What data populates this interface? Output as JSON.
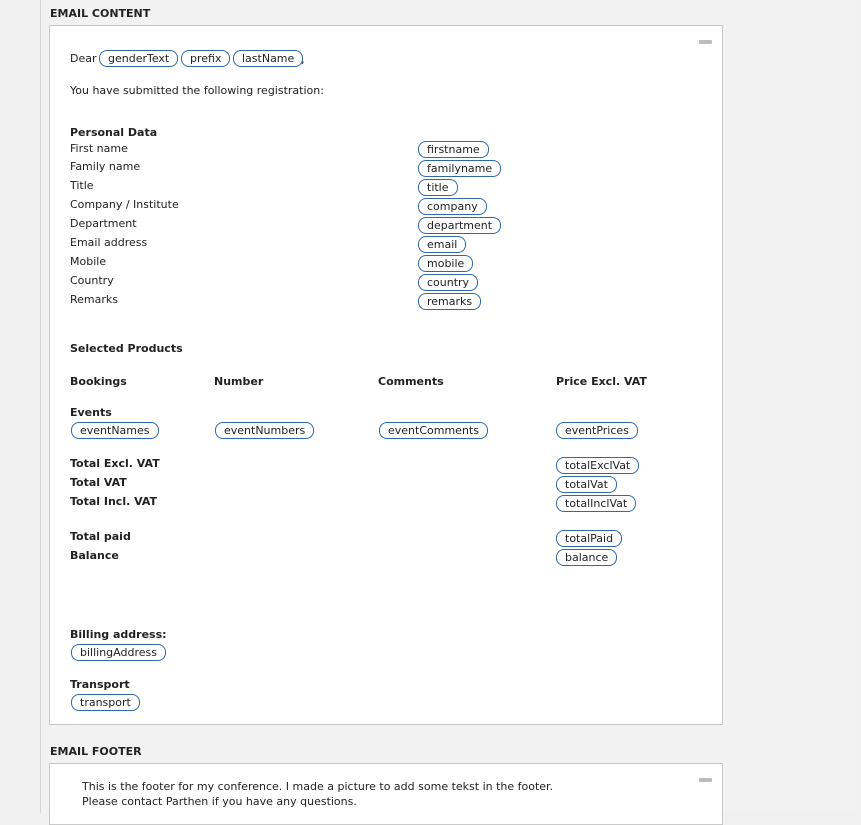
{
  "content_section": {
    "title": "EMAIL CONTENT",
    "greeting": "Dear",
    "greeting_tags": [
      "genderText",
      "prefix",
      "lastName"
    ],
    "greeting_comma": ",",
    "intro": "You have submitted the following registration:",
    "personal": {
      "heading": "Personal Data",
      "rows": [
        {
          "label": "First name",
          "tag": "firstname"
        },
        {
          "label": "Family name",
          "tag": "familyname"
        },
        {
          "label": "Title",
          "tag": "title"
        },
        {
          "label": "Company / Institute",
          "tag": "company"
        },
        {
          "label": "Department",
          "tag": "department"
        },
        {
          "label": "Email address",
          "tag": "email"
        },
        {
          "label": "Mobile",
          "tag": "mobile"
        },
        {
          "label": "Country",
          "tag": "country"
        },
        {
          "label": "Remarks",
          "tag": "remarks"
        }
      ]
    },
    "products": {
      "heading": "Selected Products",
      "columns": [
        "Bookings",
        "Number",
        "Comments",
        "Price Excl. VAT"
      ],
      "events_label": "Events",
      "event_tags": [
        "eventNames",
        "eventNumbers",
        "eventComments",
        "eventPrices"
      ]
    },
    "totals": [
      {
        "label": "Total Excl. VAT",
        "tag": "totalExclVat"
      },
      {
        "label": "Total VAT",
        "tag": "totalVat"
      },
      {
        "label": "Total Incl. VAT",
        "tag": "totalInclVat"
      }
    ],
    "payments": [
      {
        "label": "Total paid",
        "tag": "totalPaid"
      },
      {
        "label": "Balance",
        "tag": "balance"
      }
    ],
    "billing": {
      "label": "Billing address:",
      "tag": "billingAddress"
    },
    "transport": {
      "label": "Transport",
      "tag": "transport"
    }
  },
  "footer_section": {
    "title": "EMAIL FOOTER",
    "line1": "This is the footer for my conference. I made a picture to add some tekst in the footer.",
    "line2": "Please contact Parthen if you have any questions."
  }
}
